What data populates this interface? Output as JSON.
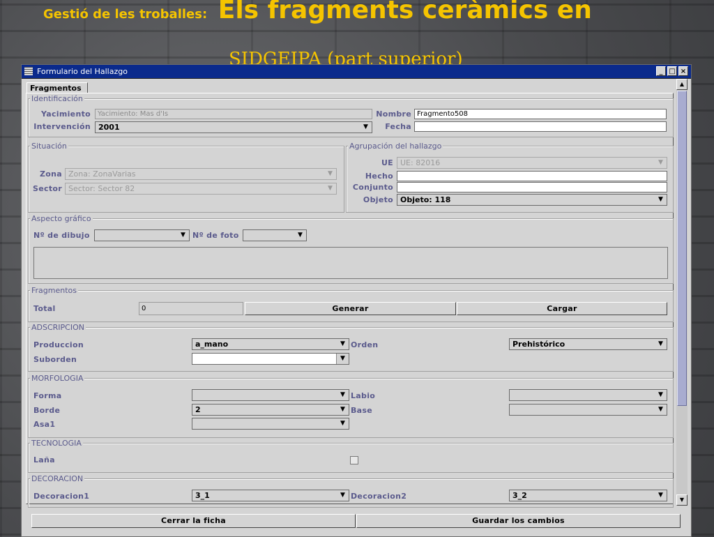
{
  "slide": {
    "title_small": "Gestió de les troballes:",
    "title_big": "Els fragments ceràmics en",
    "subtitle": "SIDGEIPA (part superior)"
  },
  "window": {
    "title": "Formulario del Hallazgo",
    "controls": [
      "_",
      "□",
      "×"
    ],
    "tab": "Fragmentos"
  },
  "identificacion": {
    "title": "Identificación",
    "yacimiento_label": "Yacimiento",
    "yacimiento_value": "Yacimiento: Mas d'Is",
    "nombre_label": "Nombre",
    "nombre_value": "Fragmento508",
    "intervencion_label": "Intervención",
    "intervencion_value": "2001",
    "fecha_label": "Fecha",
    "fecha_value": ""
  },
  "situacion": {
    "title": "Situación",
    "zona_label": "Zona",
    "zona_value": "Zona: ZonaVarias",
    "sector_label": "Sector",
    "sector_value": "Sector: Sector 82"
  },
  "agrupacion": {
    "title": "Agrupación del hallazgo",
    "ue_label": "UE",
    "ue_value": "UE: 82016",
    "hecho_label": "Hecho",
    "conjunto_label": "Conjunto",
    "objeto_label": "Objeto",
    "objeto_value": "Objeto: 118"
  },
  "aspecto": {
    "title": "Aspecto gráfico",
    "dibujo_label": "Nº de dibujo",
    "foto_label": "Nº de foto"
  },
  "fragmentos": {
    "title": "Fragmentos",
    "total_label": "Total",
    "total_value": "0",
    "generar_label": "Generar",
    "cargar_label": "Cargar"
  },
  "adscripcion": {
    "title": "ADSCRIPCION",
    "produccion_label": "Produccion",
    "produccion_value": "a_mano",
    "orden_label": "Orden",
    "orden_value": "Prehistórico",
    "suborden_label": "Suborden",
    "suborden_value": ""
  },
  "morfologia": {
    "title": "MORFOLOGIA",
    "forma_label": "Forma",
    "labio_label": "Labio",
    "borde_label": "Borde",
    "borde_value": "2",
    "base_label": "Base",
    "asa1_label": "Asa1"
  },
  "tecnologia": {
    "title": "TECNOLOGIA",
    "lana_label": "Laña"
  },
  "decoracion": {
    "title": "DECORACION",
    "decoracion1_label": "Decoracion1",
    "decoracion1_value": "3_1",
    "decoracion2_label": "Decoracion2",
    "decoracion2_value": "3_2"
  },
  "footer": {
    "cerrar_label": "Cerrar la ficha",
    "guardar_label": "Guardar los cambios"
  },
  "icons": {
    "dropdown_arrow": "▼",
    "scroll_up": "▲",
    "scroll_down": "▼"
  }
}
